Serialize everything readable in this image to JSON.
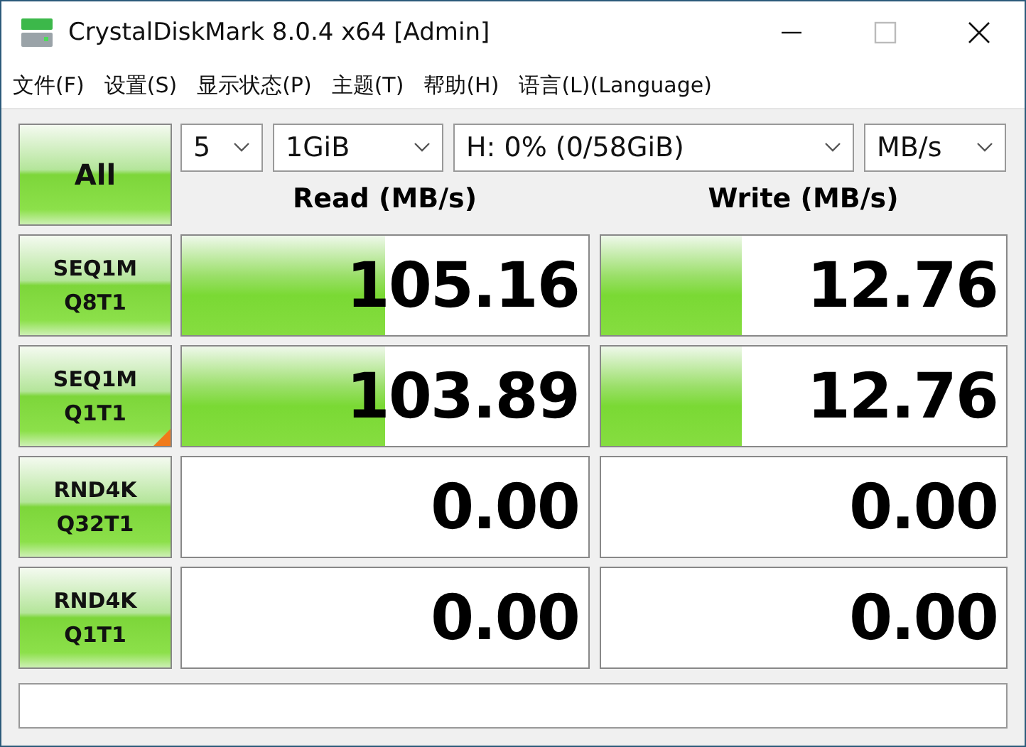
{
  "window": {
    "title": "CrystalDiskMark 8.0.4 x64 [Admin]"
  },
  "menu": [
    "文件(F)",
    "设置(S)",
    "显示状态(P)",
    "主题(T)",
    "帮助(H)",
    "语言(L)(Language)"
  ],
  "all_button": "All",
  "selectors": [
    {
      "kind": "count",
      "value": "5"
    },
    {
      "kind": "size",
      "value": "1GiB"
    },
    {
      "kind": "drive",
      "value": "H: 0% (0/58GiB)"
    },
    {
      "kind": "unit",
      "value": "MB/s"
    }
  ],
  "headers": {
    "read": "Read (MB/s)",
    "write": "Write (MB/s)"
  },
  "tests": [
    {
      "line1": "SEQ1M",
      "line2": "Q8T1",
      "flagged": false,
      "read": {
        "value": "105.16",
        "level": 0.5
      },
      "write": {
        "value": "12.76",
        "level": 0.35
      }
    },
    {
      "line1": "SEQ1M",
      "line2": "Q1T1",
      "flagged": true,
      "read": {
        "value": "103.89",
        "level": 0.5
      },
      "write": {
        "value": "12.76",
        "level": 0.35
      }
    },
    {
      "line1": "RND4K",
      "line2": "Q32T1",
      "flagged": false,
      "read": {
        "value": "0.00"
      },
      "write": {
        "value": "0.00"
      }
    },
    {
      "line1": "RND4K",
      "line2": "Q1T1",
      "flagged": false,
      "read": {
        "value": "0.00"
      },
      "write": {
        "value": "0.00"
      }
    }
  ]
}
